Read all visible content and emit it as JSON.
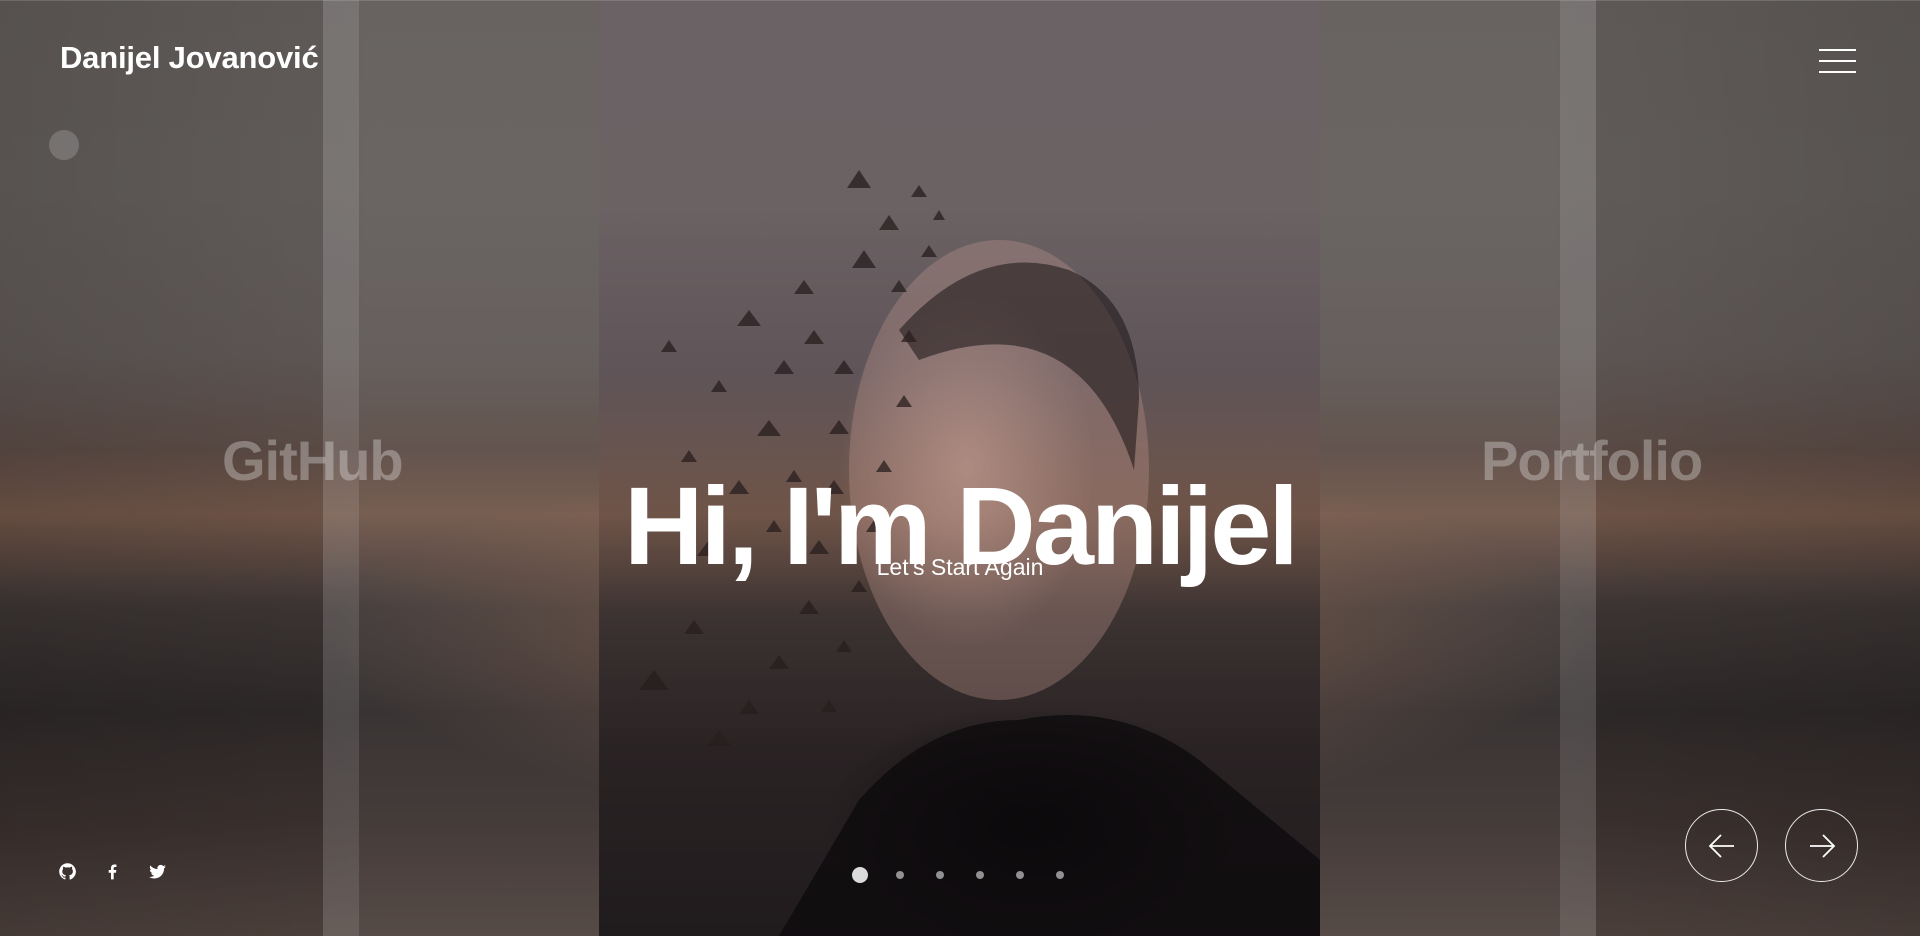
{
  "header": {
    "brand": "Danijel Jovanović",
    "menu_icon": "hamburger-menu-icon"
  },
  "slider": {
    "prev_slide_title": "GitHub",
    "current_title": "Hi, I'm Danijel",
    "current_subtitle": "Let's Start Again",
    "next_slide_title": "Portfolio",
    "slide_count": 6,
    "active_index": 0,
    "prev_icon": "arrow-left-icon",
    "next_icon": "arrow-right-icon"
  },
  "social": [
    {
      "name": "github-icon"
    },
    {
      "name": "facebook-icon"
    },
    {
      "name": "twitter-icon"
    }
  ],
  "colors": {
    "text": "#ffffff",
    "faded_text": "rgba(255,255,255,0.30)"
  }
}
